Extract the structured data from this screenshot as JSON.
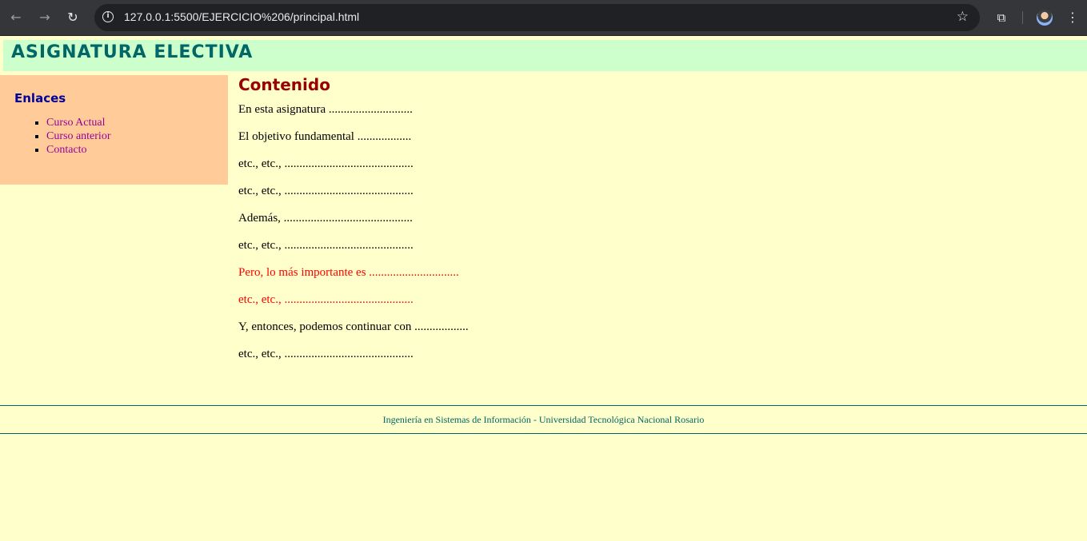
{
  "browser": {
    "url": "127.0.0.1:5500/EJERCICIO%206/principal.html",
    "back_icon": "←",
    "forward_icon": "→",
    "reload_icon": "↻",
    "info_icon": "i",
    "star_icon": "☆",
    "extensions_icon": "⧉",
    "menu_icon": "⋮"
  },
  "header": {
    "title": "ASIGNATURA ELECTIVA"
  },
  "sidebar": {
    "title": "Enlaces",
    "links": [
      {
        "label": "Curso Actual"
      },
      {
        "label": "Curso anterior"
      },
      {
        "label": "Contacto"
      }
    ]
  },
  "main": {
    "title": "Contenido",
    "paragraphs": [
      {
        "text": "En esta asignatura ............................"
      },
      {
        "text": "El objetivo fundamental .................."
      },
      {
        "text": "etc., etc., ..........................................."
      },
      {
        "text": "etc., etc., ..........................................."
      },
      {
        "text": "Además, ..........................................."
      },
      {
        "text": "etc., etc., ..........................................."
      },
      {
        "text": "Pero, lo más importante es .............................."
      },
      {
        "text": "etc., etc., ..........................................."
      },
      {
        "text": "Y, entonces, podemos continuar con .................."
      },
      {
        "text": "etc., etc., ..........................................."
      }
    ]
  },
  "footer": {
    "text": "Ingeniería en Sistemas de Información - Universidad Tecnológica Nacional Rosario"
  },
  "colors": {
    "page_background": "#ffffcc",
    "header_background": "#ccffcc",
    "sidebar_background": "#ffcc99",
    "header_text": "#006666",
    "sidebar_title": "#000099",
    "link": "#990099",
    "content_title": "#990000",
    "highlight_text": "#ff0000"
  }
}
